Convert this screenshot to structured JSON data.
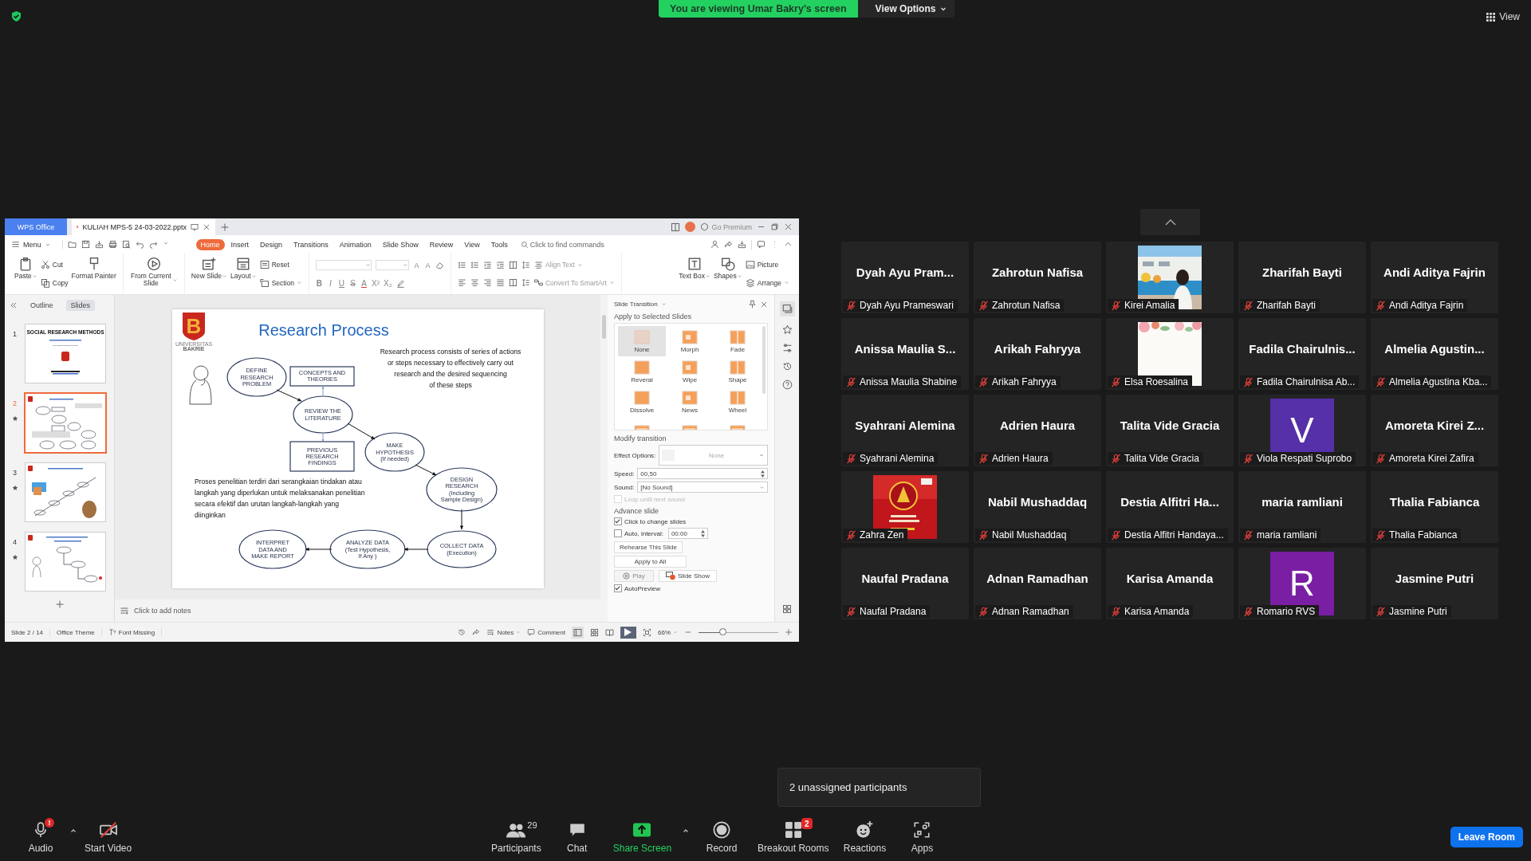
{
  "top_bar": {
    "banner": "You are viewing Umar Bakry's screen",
    "view_options": "View Options",
    "view": "View"
  },
  "wps": {
    "app_tab": "WPS Office",
    "document_tab": "KULIAH MPS-5 24-03-2022.pptx",
    "premium": "Go Premium",
    "menu": "Menu",
    "tabs": [
      {
        "label": "Home",
        "selected": true
      },
      {
        "label": "Insert",
        "selected": false
      },
      {
        "label": "Design",
        "selected": false
      },
      {
        "label": "Transitions",
        "selected": false
      },
      {
        "label": "Animation",
        "selected": false
      },
      {
        "label": "Slide Show",
        "selected": false
      },
      {
        "label": "Review",
        "selected": false
      },
      {
        "label": "View",
        "selected": false
      },
      {
        "label": "Tools",
        "selected": false
      }
    ],
    "search": {
      "placeholder": "Click to find commands"
    },
    "ribbon_groups": [
      {
        "kind": "buttons",
        "items": [
          {
            "label": "Paste",
            "kind": "large",
            "dropdown": true
          },
          {
            "label": "Cut",
            "kind": "small",
            "dropdown": false
          },
          {
            "label": "Copy",
            "kind": "small",
            "dropdown": false
          },
          {
            "label": "Format Painter",
            "kind": "large",
            "dropdown": false
          }
        ]
      },
      {
        "kind": "buttons",
        "items": [
          {
            "label": "From Current Slide",
            "kind": "large",
            "dropdown": true
          }
        ]
      },
      {
        "kind": "buttons",
        "items": [
          {
            "label": "New Slide",
            "kind": "large",
            "dropdown": true
          },
          {
            "label": "Layout",
            "kind": "large",
            "dropdown": true
          },
          {
            "label": "Reset",
            "kind": "small",
            "dropdown": false
          },
          {
            "label": "Section",
            "kind": "small",
            "dropdown": true
          }
        ]
      },
      {
        "kind": "font",
        "size_glyphs": [
          "A",
          "A"
        ],
        "glyphs": [
          "B",
          "I",
          "U",
          "S",
          "A",
          "X²",
          "X₂"
        ]
      },
      {
        "kind": "paragraph",
        "items": [
          {
            "label": "Align Text",
            "dropdown": true
          },
          {
            "label": "Convert To SmartArt",
            "dropdown": true
          }
        ]
      },
      {
        "kind": "buttons",
        "items": [
          {
            "label": "Text Box",
            "kind": "large",
            "dropdown": true
          },
          {
            "label": "Shapes",
            "kind": "large",
            "dropdown": true
          },
          {
            "label": "Picture",
            "kind": "small",
            "dropdown": false
          },
          {
            "label": "Arrange",
            "kind": "small",
            "dropdown": true
          }
        ]
      }
    ],
    "panel_tabs": [
      {
        "label": "Outline",
        "selected": false
      },
      {
        "label": "Slides",
        "selected": true
      }
    ],
    "slides": [
      {
        "number": "1",
        "selected": false,
        "animated": false,
        "title": "SOCIAL RESEARCH METHODS"
      },
      {
        "number": "2",
        "selected": true,
        "animated": true
      },
      {
        "number": "3",
        "selected": false,
        "animated": true
      },
      {
        "number": "4",
        "selected": false,
        "animated": true
      }
    ],
    "slide": {
      "logo_letter": "B",
      "logo_caption": [
        "UNIVERSITAS",
        "BAKRIE"
      ],
      "title": "Research Process",
      "description": [
        "Research process consists of series of actions",
        "or steps necessary to effectively carry out",
        "research and the desired sequencing",
        "of these steps"
      ],
      "description_local": [
        "Proses penelitian terdiri dari serangkaian tindakan atau",
        "langkah yang diperlukan untuk melaksanakan penelitian",
        "secara efektif dan urutan langkah-langkah yang",
        "diinginkan"
      ],
      "nodes": [
        {
          "kind": "ellipse",
          "lines": [
            "DEFINE",
            "RESEARCH",
            "PROBLEM"
          ]
        },
        {
          "kind": "box",
          "lines": [
            "CONCEPTS AND",
            "THEORIES"
          ]
        },
        {
          "kind": "ellipse",
          "lines": [
            "REVIEW THE",
            "LITERATURE"
          ]
        },
        {
          "kind": "box",
          "lines": [
            "PREVIOUS",
            "RESEARCH",
            "FINDINGS"
          ]
        },
        {
          "kind": "ellipse",
          "lines": [
            "MAKE",
            "HYPOTHESIS",
            "(If needed)"
          ]
        },
        {
          "kind": "ellipse",
          "lines": [
            "DESIGN",
            "RESEARCH",
            "(Including",
            "Sample Design)"
          ]
        },
        {
          "kind": "ellipse",
          "lines": [
            "INTERPRET",
            "DATA AND",
            "MAKE REPORT"
          ]
        },
        {
          "kind": "ellipse",
          "lines": [
            "ANALYZE DATA",
            "(Test Hypothesis,",
            "If Any )"
          ]
        },
        {
          "kind": "ellipse",
          "lines": [
            "COLLECT DATA",
            "(Execution)"
          ]
        }
      ]
    },
    "notes": {
      "placeholder": "Click to add notes"
    },
    "transition_pane": {
      "title": "Slide Transition",
      "apply_heading": "Apply to Selected Slides",
      "transitions": [
        {
          "label": "None",
          "selected": true
        },
        {
          "label": "Morph",
          "selected": false
        },
        {
          "label": "Fade",
          "selected": false
        },
        {
          "label": "Reveral",
          "selected": false
        },
        {
          "label": "Wipe",
          "selected": false
        },
        {
          "label": "Shape",
          "selected": false
        },
        {
          "label": "Dissolve",
          "selected": false
        },
        {
          "label": "News",
          "selected": false
        },
        {
          "label": "Wheel",
          "selected": false
        }
      ],
      "modify_heading": "Modify transition",
      "effect_label": "Effect Options:",
      "effect_value": "None",
      "speed_label": "Speed:",
      "speed_value": "00,50",
      "sound_label": "Sound:",
      "sound_value": "[No Sound]",
      "loop": {
        "label": "Loop until next sound",
        "checked": false,
        "disabled": true
      },
      "advance_heading": "Advance slide",
      "click_change": {
        "label": "Click to change slides",
        "checked": true
      },
      "auto": {
        "label": "Auto, interval:",
        "checked": false,
        "value": "00:00"
      },
      "rehearse": "Rehearse This Slide",
      "apply_all": "Apply to All",
      "play": {
        "label": "Play",
        "disabled": true
      },
      "slide_show": "Slide Show",
      "autopreview": {
        "label": "AutoPreview",
        "checked": true
      }
    },
    "status_bar": {
      "slide": "Slide 2 / 14",
      "theme": "Office Theme",
      "font_missing": "Font Missing",
      "notes": "Notes",
      "comment": "Comment",
      "zoom": {
        "value": "66%",
        "level": 0.31
      }
    }
  },
  "participants": [
    {
      "kind": "name",
      "display": "Dyah Ayu Pram...",
      "name": "Dyah Ayu Prameswari",
      "muted": true
    },
    {
      "kind": "name",
      "display": "Zahrotun Nafisa",
      "name": "Zahrotun Nafisa",
      "muted": true
    },
    {
      "kind": "picture",
      "name": "Kirei Amalia",
      "muted": true
    },
    {
      "kind": "name",
      "display": "Zharifah Bayti",
      "name": "Zharifah Bayti",
      "muted": true
    },
    {
      "kind": "name",
      "display": "Andi Aditya Fajrin",
      "name": "Andi Aditya Fajrin",
      "muted": true
    },
    {
      "kind": "name",
      "display": "Anissa Maulia S...",
      "name": "Anissa Maulia Shabine",
      "muted": true
    },
    {
      "kind": "name",
      "display": "Arikah Fahryya",
      "name": "Arikah Fahryya",
      "muted": true
    },
    {
      "kind": "picture",
      "name": "Elsa Roesalina",
      "muted": true
    },
    {
      "kind": "name",
      "display": "Fadila Chairulnis...",
      "name": "Fadila Chairulnisa Ab...",
      "muted": true
    },
    {
      "kind": "name",
      "display": "Almelia Agustin...",
      "name": "Almelia Agustina Kba...",
      "muted": true
    },
    {
      "kind": "name",
      "display": "Syahrani Alemina",
      "name": "Syahrani Alemina",
      "muted": true
    },
    {
      "kind": "name",
      "display": "Adrien Haura",
      "name": "Adrien Haura",
      "muted": true
    },
    {
      "kind": "name",
      "display": "Talita Vide Gracia",
      "name": "Talita Vide Gracia",
      "muted": true
    },
    {
      "kind": "initial",
      "initial": "V",
      "color": "#5530a8",
      "name": "Viola Respati Suprobo",
      "muted": true
    },
    {
      "kind": "name",
      "display": "Amoreta Kirei Z...",
      "name": "Amoreta Kirei Zafira",
      "muted": true
    },
    {
      "kind": "picture",
      "name": "Zahra Zen",
      "muted": true
    },
    {
      "kind": "name",
      "display": "Nabil Mushaddaq",
      "name": "Nabil Mushaddaq",
      "muted": true
    },
    {
      "kind": "name",
      "display": "Destia Alfitri Ha...",
      "name": "Destia Alfitri Handaya...",
      "muted": true
    },
    {
      "kind": "name",
      "display": "maria ramliani",
      "name": "maria ramliani",
      "muted": true
    },
    {
      "kind": "name",
      "display": "Thalia Fabianca",
      "name": "Thalia Fabianca",
      "muted": true
    },
    {
      "kind": "name",
      "display": "Naufal Pradana",
      "name": "Naufal Pradana",
      "muted": true
    },
    {
      "kind": "name",
      "display": "Adnan Ramadhan",
      "name": "Adnan Ramadhan",
      "muted": true
    },
    {
      "kind": "name",
      "display": "Karisa Amanda",
      "name": "Karisa Amanda",
      "muted": true
    },
    {
      "kind": "initial",
      "initial": "R",
      "color": "#7a1ea3",
      "name": "Romario RVS",
      "muted": true
    },
    {
      "kind": "name",
      "display": "Jasmine Putri",
      "name": "Jasmine Putri",
      "muted": true
    }
  ],
  "popup": "2 unassigned participants",
  "toolbar": {
    "audio": {
      "label": "Audio",
      "badge": "!"
    },
    "video": "Start Video",
    "participants": {
      "label": "Participants",
      "count": "29"
    },
    "chat": "Chat",
    "share": "Share Screen",
    "record": "Record",
    "breakout": {
      "label": "Breakout Rooms",
      "badge": "2"
    },
    "reactions": "Reactions",
    "apps": "Apps",
    "leave": "Leave Room"
  }
}
